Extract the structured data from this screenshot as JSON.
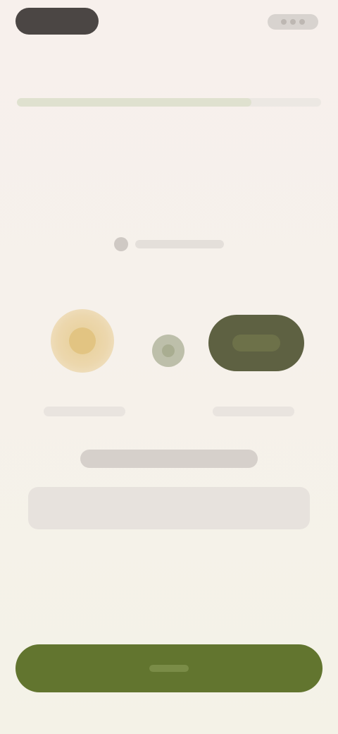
{
  "top_bar": {
    "back_label": "",
    "back_icon": "back-icon",
    "status_icons": [
      "status-dot-icon",
      "status-dot-icon",
      "status-dot-icon"
    ]
  },
  "step": {
    "caption": "",
    "progress": 0.77
  },
  "connect": {
    "icon": "link-icon",
    "label": ""
  },
  "pairing": {
    "device_a_icon": "sun-icon",
    "device_a_caption": "",
    "link_icon": "link-dot-icon",
    "device_b_icon": "device-icon",
    "device_b_caption": ""
  },
  "content": {
    "title": "",
    "description": ""
  },
  "primary_button": {
    "label": ""
  },
  "colors": {
    "background": "#f6f1ec",
    "accent": "#62752f",
    "device_a": "#e8cf97",
    "device_b": "#5e6142",
    "back_pill": "#4b4644"
  }
}
